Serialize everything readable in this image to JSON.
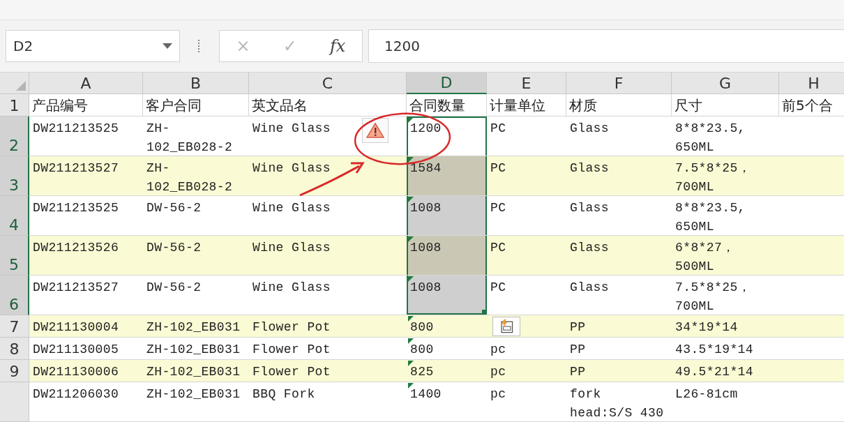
{
  "formula_bar": {
    "name_box": "D2",
    "cancel": "×",
    "enter": "✓",
    "function": "fx",
    "value": "1200"
  },
  "columns": [
    {
      "label": "A",
      "selected": false
    },
    {
      "label": "B",
      "selected": false
    },
    {
      "label": "C",
      "selected": false
    },
    {
      "label": "D",
      "selected": true
    },
    {
      "label": "E",
      "selected": false
    },
    {
      "label": "F",
      "selected": false
    },
    {
      "label": "G",
      "selected": false
    },
    {
      "label": "H",
      "selected": false
    }
  ],
  "rows": [
    {
      "number": "1",
      "header_selected": false,
      "banded": false,
      "tall": false,
      "cells": [
        {
          "text": "产品编号",
          "selected": false
        },
        {
          "text": "客户合同",
          "selected": false
        },
        {
          "text": "英文品名",
          "selected": false
        },
        {
          "text": "合同数量",
          "selected": false,
          "error_mark": false
        },
        {
          "text": "计量单位",
          "selected": false
        },
        {
          "text": "材质",
          "selected": false
        },
        {
          "text": "尺寸",
          "selected": false
        },
        {
          "text": "前5个合",
          "selected": false
        }
      ]
    },
    {
      "number": "2",
      "header_selected": true,
      "banded": false,
      "tall": true,
      "cells": [
        {
          "text": "DW211213525",
          "selected": false
        },
        {
          "text": "ZH-102_EB028-2",
          "selected": false
        },
        {
          "text": "Wine Glass",
          "selected": false,
          "warning": true
        },
        {
          "text": "1200",
          "selected": true,
          "active": true,
          "error_mark": true
        },
        {
          "text": "PC",
          "selected": false
        },
        {
          "text": "Glass",
          "selected": false
        },
        {
          "text": "8*8*23.5, 650ML",
          "selected": false
        }
      ]
    },
    {
      "number": "3",
      "header_selected": true,
      "banded": true,
      "tall": true,
      "cells": [
        {
          "text": "DW211213527",
          "selected": false
        },
        {
          "text": "ZH-102_EB028-2",
          "selected": false
        },
        {
          "text": "Wine Glass",
          "selected": false
        },
        {
          "text": "1584",
          "selected": true,
          "active": false,
          "error_mark": true
        },
        {
          "text": "PC",
          "selected": false
        },
        {
          "text": "Glass",
          "selected": false
        },
        {
          "text": "7.5*8*25，700ML",
          "selected": false
        }
      ]
    },
    {
      "number": "4",
      "header_selected": true,
      "banded": false,
      "tall": true,
      "cells": [
        {
          "text": "DW211213525",
          "selected": false
        },
        {
          "text": "DW-56-2",
          "selected": false
        },
        {
          "text": "Wine Glass",
          "selected": false
        },
        {
          "text": "1008",
          "selected": true,
          "active": false,
          "error_mark": true
        },
        {
          "text": "PC",
          "selected": false
        },
        {
          "text": "Glass",
          "selected": false
        },
        {
          "text": "8*8*23.5, 650ML",
          "selected": false
        }
      ]
    },
    {
      "number": "5",
      "header_selected": true,
      "banded": true,
      "tall": true,
      "cells": [
        {
          "text": "DW211213526",
          "selected": false
        },
        {
          "text": "DW-56-2",
          "selected": false
        },
        {
          "text": "Wine Glass",
          "selected": false
        },
        {
          "text": "1008",
          "selected": true,
          "active": false,
          "error_mark": true
        },
        {
          "text": "PC",
          "selected": false
        },
        {
          "text": "Glass",
          "selected": false
        },
        {
          "text": "6*8*27，500ML",
          "selected": false
        }
      ]
    },
    {
      "number": "6",
      "header_selected": true,
      "banded": false,
      "tall": true,
      "cells": [
        {
          "text": "DW211213527",
          "selected": false
        },
        {
          "text": "DW-56-2",
          "selected": false
        },
        {
          "text": "Wine Glass",
          "selected": false
        },
        {
          "text": "1008",
          "selected": true,
          "active": false,
          "error_mark": true
        },
        {
          "text": "PC",
          "selected": false
        },
        {
          "text": "Glass",
          "selected": false
        },
        {
          "text": "7.5*8*25，700ML",
          "selected": false
        }
      ]
    },
    {
      "number": "7",
      "header_selected": false,
      "banded": true,
      "tall": false,
      "cells": [
        {
          "text": "DW211130004",
          "selected": false
        },
        {
          "text": "ZH-102_EB031",
          "selected": false
        },
        {
          "text": "Flower Pot",
          "selected": false
        },
        {
          "text": "800",
          "selected": false,
          "error_mark": true
        },
        {
          "selected": false
        },
        {
          "text": "PP",
          "selected": false
        },
        {
          "text": "34*19*14",
          "selected": false
        }
      ]
    },
    {
      "number": "8",
      "header_selected": false,
      "banded": false,
      "tall": false,
      "cells": [
        {
          "text": "DW211130005",
          "selected": false
        },
        {
          "text": "ZH-102_EB031",
          "selected": false
        },
        {
          "text": "Flower Pot",
          "selected": false
        },
        {
          "text": "800",
          "selected": false,
          "error_mark": true
        },
        {
          "text": "pc",
          "selected": false
        },
        {
          "text": "PP",
          "selected": false
        },
        {
          "text": "43.5*19*14",
          "selected": false
        }
      ]
    },
    {
      "number": "9",
      "header_selected": false,
      "banded": true,
      "tall": false,
      "cells": [
        {
          "text": "DW211130006",
          "selected": false
        },
        {
          "text": "ZH-102_EB031",
          "selected": false
        },
        {
          "text": "Flower Pot",
          "selected": false
        },
        {
          "text": "825",
          "selected": false,
          "error_mark": true
        },
        {
          "text": "pc",
          "selected": false
        },
        {
          "text": "PP",
          "selected": false
        },
        {
          "text": "49.5*21*14",
          "selected": false
        }
      ]
    },
    {
      "header_selected": false,
      "banded": false,
      "tall": true,
      "cells": [
        {
          "text": "DW211206030",
          "selected": false
        },
        {
          "text": "ZH-102_EB031",
          "selected": false
        },
        {
          "text": "BBQ Fork",
          "selected": false
        },
        {
          "text": "1400",
          "selected": false,
          "error_mark": true
        },
        {
          "text": "pc",
          "selected": false
        },
        {
          "text": "fork head:S/S 430",
          "selected": false
        },
        {
          "text": "L26-81cm",
          "selected": false
        }
      ]
    }
  ]
}
